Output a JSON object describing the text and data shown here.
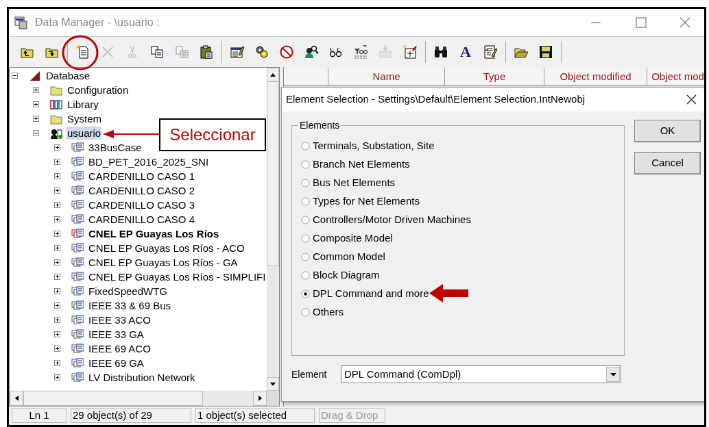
{
  "window": {
    "title": "Data Manager - \\usuario :"
  },
  "toolbar": {
    "groups": [
      [
        {
          "disabled": false
        },
        {
          "disabled": false
        }
      ],
      [
        {
          "disabled": false
        },
        {
          "disabled": true
        },
        {
          "disabled": true
        },
        {
          "disabled": false
        },
        {
          "disabled": true
        },
        {
          "disabled": false
        }
      ],
      [
        {
          "disabled": false
        },
        {
          "disabled": false
        },
        {
          "disabled": false
        },
        {
          "disabled": false
        },
        {
          "disabled": false
        },
        {
          "disabled": false
        },
        {
          "disabled": true
        },
        {
          "disabled": false
        }
      ],
      [
        {
          "disabled": false
        },
        {
          "disabled": false,
          "glyph": "A"
        },
        {
          "disabled": false
        }
      ],
      [
        {
          "disabled": false
        },
        {
          "disabled": false
        }
      ]
    ]
  },
  "tree": {
    "items": [
      {
        "label": "Database",
        "kind": "database",
        "expanded": true,
        "selected": false,
        "children": [
          {
            "label": "Configuration",
            "kind": "folder",
            "expanded": false,
            "selected": false
          },
          {
            "label": "Library",
            "kind": "library",
            "expanded": false,
            "selected": false
          },
          {
            "label": "System",
            "kind": "folder",
            "expanded": false,
            "selected": false
          },
          {
            "label": "usuario",
            "kind": "user",
            "expanded": true,
            "selected": true,
            "children": [
              {
                "label": "33BusCase",
                "kind": "project",
                "active": false,
                "expanded": false,
                "selected": false
              },
              {
                "label": "BD_PET_2016_2025_SNI",
                "kind": "project",
                "active": false,
                "expanded": false,
                "selected": false
              },
              {
                "label": "CARDENILLO CASO 1",
                "kind": "project",
                "active": false,
                "expanded": false,
                "selected": false
              },
              {
                "label": "CARDENILLO CASO 2",
                "kind": "project",
                "active": false,
                "expanded": false,
                "selected": false
              },
              {
                "label": "CARDENILLO CASO 3",
                "kind": "project",
                "active": false,
                "expanded": false,
                "selected": false
              },
              {
                "label": "CARDENILLO CASO 4",
                "kind": "project",
                "active": false,
                "expanded": false,
                "selected": false
              },
              {
                "label": "CNEL EP Guayas Los Ríos",
                "kind": "project",
                "active": true,
                "expanded": false,
                "selected": false
              },
              {
                "label": "CNEL EP Guayas Los Ríos - ACO",
                "kind": "project",
                "active": false,
                "expanded": false,
                "selected": false
              },
              {
                "label": "CNEL EP Guayas Los Ríos - GA",
                "kind": "project",
                "active": false,
                "expanded": false,
                "selected": false
              },
              {
                "label": "CNEL EP Guayas Los Ríos - SIMPLIFI",
                "kind": "project",
                "active": false,
                "expanded": false,
                "selected": false
              },
              {
                "label": "FixedSpeedWTG",
                "kind": "project",
                "active": false,
                "expanded": false,
                "selected": false
              },
              {
                "label": "IEEE 33 & 69 Bus",
                "kind": "project",
                "active": false,
                "expanded": false,
                "selected": false
              },
              {
                "label": "IEEE 33 ACO",
                "kind": "project",
                "active": false,
                "expanded": false,
                "selected": false
              },
              {
                "label": "IEEE 33 GA",
                "kind": "project",
                "active": false,
                "expanded": false,
                "selected": false
              },
              {
                "label": "IEEE 69 ACO",
                "kind": "project",
                "active": false,
                "expanded": false,
                "selected": false
              },
              {
                "label": "IEEE 69 GA",
                "kind": "project",
                "active": false,
                "expanded": false,
                "selected": false
              },
              {
                "label": "LV Distribution Network",
                "kind": "project",
                "active": false,
                "expanded": false,
                "selected": false
              }
            ]
          }
        ]
      }
    ]
  },
  "table": {
    "columns": [
      "",
      "Name",
      "Type",
      "Object modified",
      "Object mod"
    ]
  },
  "dialog": {
    "title": "Element Selection - Settings\\Default\\Element Selection.IntNewobj",
    "group_label": "Elements",
    "options": [
      {
        "label": "Terminals, Substation, Site",
        "selected": false
      },
      {
        "label": "Branch Net Elements",
        "selected": false
      },
      {
        "label": "Bus Net Elements",
        "selected": false
      },
      {
        "label": "Types for Net Elements",
        "selected": false
      },
      {
        "label": "Controllers/Motor Driven Machines",
        "selected": false
      },
      {
        "label": "Composite Model",
        "selected": false
      },
      {
        "label": "Common Model",
        "selected": false
      },
      {
        "label": "Block Diagram",
        "selected": false
      },
      {
        "label": "DPL Command and more",
        "selected": true
      },
      {
        "label": "Others",
        "selected": false
      }
    ],
    "buttons": [
      "OK",
      "Cancel"
    ],
    "element_label": "Element",
    "element_value": "DPL Command (ComDpl)"
  },
  "status_bar": [
    {
      "text": "Ln 1",
      "disabled": false
    },
    {
      "text": "29 object(s) of 29",
      "disabled": false
    },
    {
      "text": "1 object(s) selected",
      "disabled": false
    },
    {
      "text": "Drag & Drop",
      "disabled": true
    }
  ],
  "annotations": {
    "callout": "Seleccionar"
  }
}
